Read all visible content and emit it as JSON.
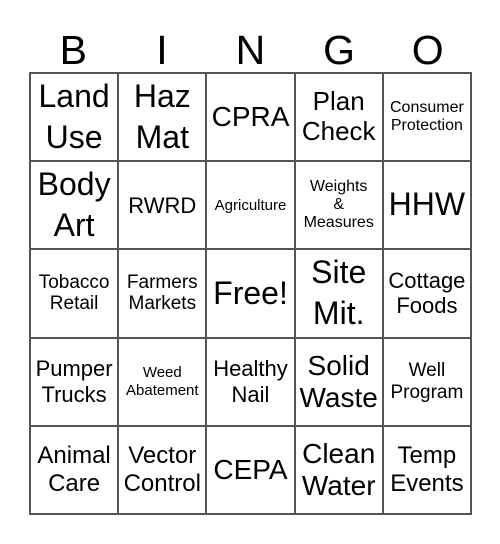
{
  "header": [
    "B",
    "I",
    "N",
    "G",
    "O"
  ],
  "cells": [
    "Land\nUse",
    "Haz\nMat",
    "CPRA",
    "Plan\nCheck",
    "Consumer\nProtection",
    "Body\nArt",
    "RWRD",
    "Agriculture",
    "Weights\n&\nMeasures",
    "HHW",
    "Tobacco\nRetail",
    "Farmers\nMarkets",
    "Free!",
    "Site\nMit.",
    "Cottage\nFoods",
    "Pumper\nTrucks",
    "Weed\nAbatement",
    "Healthy\nNail",
    "Solid\nWaste",
    "Well\nProgram",
    "Animal\nCare",
    "Vector\nControl",
    "CEPA",
    "Clean\nWater",
    "Temp\nEvents"
  ]
}
